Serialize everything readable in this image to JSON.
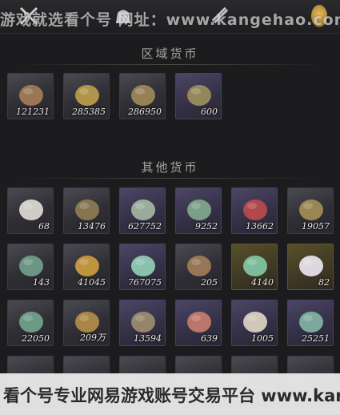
{
  "watermark_top": "游戏就选看个号  网址：www.kangehao.com",
  "watermark_bottom": "看个号专业网易游戏账号交易平台 www.kangehao.com",
  "tabs": [
    {
      "icon": "crossed-swords-icon"
    },
    {
      "icon": "pouch-icon"
    },
    {
      "icon": "scroll-icon"
    },
    {
      "icon": "coin-tab-icon"
    }
  ],
  "sections": [
    {
      "title": "区域货币",
      "items": [
        {
          "icon": "copper-coin-stack-icon",
          "count": "121231",
          "color": "#a07a55"
        },
        {
          "icon": "gold-coin-stack-icon",
          "count": "285385",
          "color": "#b89a4c"
        },
        {
          "icon": "bronze-coin-stack-icon",
          "count": "286950",
          "color": "#9c8658"
        },
        {
          "icon": "jade-pendant-icon",
          "count": "600",
          "color": "#9a8c5a"
        }
      ]
    },
    {
      "title": "其他货币",
      "items": [
        {
          "icon": "crescent-moon-icon",
          "count": "68",
          "color": "#d9d6cf"
        },
        {
          "icon": "square-hole-coin-icon",
          "count": "13476",
          "color": "#8a7a52"
        },
        {
          "icon": "bamboo-token-icon",
          "count": "627752",
          "color": "#9fb3a0"
        },
        {
          "icon": "jade-banknote-icon",
          "count": "9252",
          "color": "#7fa58a"
        },
        {
          "icon": "red-feather-icon",
          "count": "13662",
          "color": "#b84a4a"
        },
        {
          "icon": "half-coin-icon",
          "count": "19057",
          "color": "#a08a55"
        },
        {
          "icon": "green-jade-disc-icon",
          "count": "143",
          "color": "#6f9c88"
        },
        {
          "icon": "golden-shell-icon",
          "count": "41045",
          "color": "#c79a3e"
        },
        {
          "icon": "jade-stone-icon",
          "count": "767075",
          "color": "#8fc9b2"
        },
        {
          "icon": "bronze-plaque-icon",
          "count": "205",
          "color": "#9c7a5a"
        },
        {
          "icon": "jade-ring-icon",
          "count": "4140",
          "color": "#7fc4a0"
        },
        {
          "icon": "pearl-icon",
          "count": "82",
          "color": "#e6e0ea"
        },
        {
          "icon": "jade-dragon-icon",
          "count": "22050",
          "color": "#6fa08c"
        },
        {
          "icon": "gold-bracelet-icon",
          "count": "209万",
          "color": "#b08a4a"
        },
        {
          "icon": "key-coin-icon",
          "count": "13594",
          "color": "#9a8a6a"
        },
        {
          "icon": "cinnabar-coin-icon",
          "count": "639",
          "color": "#c27a6a"
        },
        {
          "icon": "bone-slips-icon",
          "count": "1005",
          "color": "#d8d0c0"
        },
        {
          "icon": "jade-fish-icon",
          "count": "25251",
          "color": "#7fb0a0"
        }
      ]
    }
  ]
}
